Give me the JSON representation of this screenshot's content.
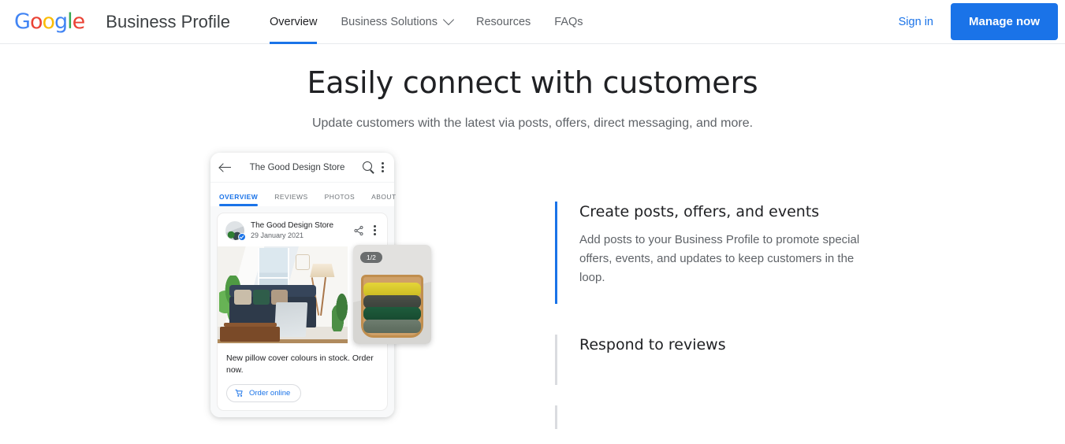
{
  "header": {
    "logo": {
      "name": "Google",
      "letters": [
        {
          "ch": "G",
          "color": "#4285F4"
        },
        {
          "ch": "o",
          "color": "#EA4335"
        },
        {
          "ch": "o",
          "color": "#FBBC05"
        },
        {
          "ch": "g",
          "color": "#4285F4"
        },
        {
          "ch": "l",
          "color": "#34A853"
        },
        {
          "ch": "e",
          "color": "#EA4335"
        }
      ]
    },
    "product_name": "Business Profile",
    "nav": [
      {
        "label": "Overview",
        "active": true,
        "has_chevron": false
      },
      {
        "label": "Business Solutions",
        "active": false,
        "has_chevron": true
      },
      {
        "label": "Resources",
        "active": false,
        "has_chevron": false
      },
      {
        "label": "FAQs",
        "active": false,
        "has_chevron": false
      }
    ],
    "sign_in": "Sign in",
    "manage_now": "Manage now",
    "accent_color": "#1a73e8"
  },
  "hero": {
    "title": "Easily connect with customers",
    "subtitle": "Update customers with the latest via posts, offers, direct messaging, and more."
  },
  "phone": {
    "topbar": {
      "back_label": "Back",
      "title": "The Good Design Store",
      "search_label": "Search",
      "menu_label": "More options"
    },
    "tabs": [
      {
        "label": "OVERVIEW",
        "active": true
      },
      {
        "label": "REVIEWS",
        "active": false
      },
      {
        "label": "PHOTOS",
        "active": false
      },
      {
        "label": "ABOUT",
        "active": false
      }
    ],
    "post": {
      "store_name": "The Good Design Store",
      "date": "29 January 2021",
      "verified": true,
      "share_label": "Share",
      "menu_label": "More options",
      "image_counter": "1/2",
      "text": "New pillow cover colours in stock. Order now.",
      "cta_label": "Order online",
      "cta_color": "#1a73e8"
    }
  },
  "features": [
    {
      "title": "Create posts, offers, and events",
      "body": "Add posts to your Business Profile to promote special offers, events, and updates to keep customers in the loop.",
      "active": true
    },
    {
      "title": "Respond to reviews",
      "body": "",
      "active": false
    },
    {
      "title": "",
      "body": "",
      "active": false
    }
  ]
}
